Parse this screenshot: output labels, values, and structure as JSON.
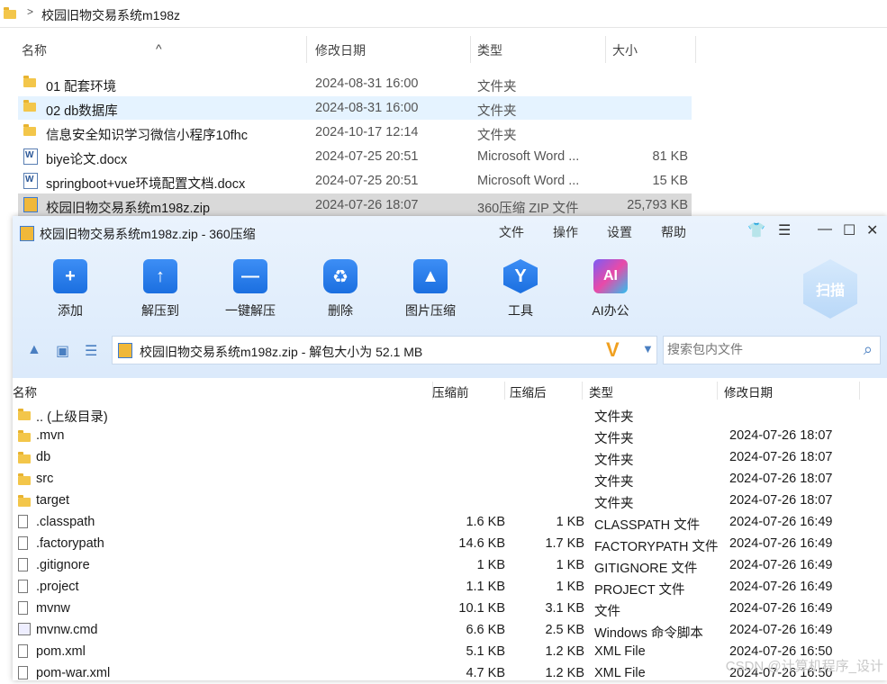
{
  "explorer": {
    "path": "校园旧物交易系统m198z",
    "columns": {
      "name": "名称",
      "modified": "修改日期",
      "type": "类型",
      "size": "大小"
    },
    "files": [
      {
        "name": "01 配套环境",
        "modified": "2024-08-31 16:00",
        "type": "文件夹",
        "size": "",
        "icon": "folder-icon"
      },
      {
        "name": "02 db数据库",
        "modified": "2024-08-31 16:00",
        "type": "文件夹",
        "size": "",
        "icon": "folder-icon"
      },
      {
        "name": "信息安全知识学习微信小程序10fhc",
        "modified": "2024-10-17 12:14",
        "type": "文件夹",
        "size": "",
        "icon": "folder-icon"
      },
      {
        "name": "biye论文.docx",
        "modified": "2024-07-25 20:51",
        "type": "Microsoft Word ...",
        "size": "81 KB",
        "icon": "word-icon"
      },
      {
        "name": "springboot+vue环境配置文档.docx",
        "modified": "2024-07-25 20:51",
        "type": "Microsoft Word ...",
        "size": "15 KB",
        "icon": "word-icon"
      },
      {
        "name": "校园旧物交易系统m198z.zip",
        "modified": "2024-07-26 18:07",
        "type": "360压缩 ZIP 文件",
        "size": "25,793 KB",
        "icon": "zip-icon"
      }
    ]
  },
  "zip": {
    "title": "校园旧物交易系统m198z.zip - 360压缩",
    "menu": [
      "文件",
      "操作",
      "设置",
      "帮助"
    ],
    "toolbar": [
      "添加",
      "解压到",
      "一键解压",
      "删除",
      "图片压缩",
      "工具",
      "AI办公"
    ],
    "scan_label": "扫描",
    "path_text": "校园旧物交易系统m198z.zip - 解包大小为 52.1 MB",
    "search_placeholder": "搜索包内文件",
    "columns": {
      "name": "名称",
      "compressed": "压缩前",
      "uncompressed": "压缩后",
      "type": "类型",
      "modified": "修改日期"
    },
    "rows": [
      {
        "name": ".. (上级目录)",
        "before": "",
        "after": "",
        "type": "文件夹",
        "modified": "",
        "icon": "folder-icon"
      },
      {
        "name": ".mvn",
        "before": "",
        "after": "",
        "type": "文件夹",
        "modified": "2024-07-26 18:07",
        "icon": "folder-icon"
      },
      {
        "name": "db",
        "before": "",
        "after": "",
        "type": "文件夹",
        "modified": "2024-07-26 18:07",
        "icon": "folder-icon"
      },
      {
        "name": "src",
        "before": "",
        "after": "",
        "type": "文件夹",
        "modified": "2024-07-26 18:07",
        "icon": "folder-icon"
      },
      {
        "name": "target",
        "before": "",
        "after": "",
        "type": "文件夹",
        "modified": "2024-07-26 18:07",
        "icon": "folder-icon"
      },
      {
        "name": ".classpath",
        "before": "1.6 KB",
        "after": "1 KB",
        "type": "CLASSPATH 文件",
        "modified": "2024-07-26 16:49",
        "icon": "file-icon"
      },
      {
        "name": ".factorypath",
        "before": "14.6 KB",
        "after": "1.7 KB",
        "type": "FACTORYPATH 文件",
        "modified": "2024-07-26 16:49",
        "icon": "file-icon"
      },
      {
        "name": ".gitignore",
        "before": "1 KB",
        "after": "1 KB",
        "type": "GITIGNORE 文件",
        "modified": "2024-07-26 16:49",
        "icon": "file-icon"
      },
      {
        "name": ".project",
        "before": "1.1 KB",
        "after": "1 KB",
        "type": "PROJECT 文件",
        "modified": "2024-07-26 16:49",
        "icon": "file-icon"
      },
      {
        "name": "mvnw",
        "before": "10.1 KB",
        "after": "3.1 KB",
        "type": "文件",
        "modified": "2024-07-26 16:49",
        "icon": "file-icon"
      },
      {
        "name": "mvnw.cmd",
        "before": "6.6 KB",
        "after": "2.5 KB",
        "type": "Windows 命令脚本",
        "modified": "2024-07-26 16:49",
        "icon": "cmd-icon"
      },
      {
        "name": "pom.xml",
        "before": "5.1 KB",
        "after": "1.2 KB",
        "type": "XML File",
        "modified": "2024-07-26 16:50",
        "icon": "file-icon"
      },
      {
        "name": "pom-war.xml",
        "before": "4.7 KB",
        "after": "1.2 KB",
        "type": "XML File",
        "modified": "2024-07-26 16:50",
        "icon": "file-icon"
      }
    ]
  },
  "watermark": "CSDN @计算机程序_设计"
}
